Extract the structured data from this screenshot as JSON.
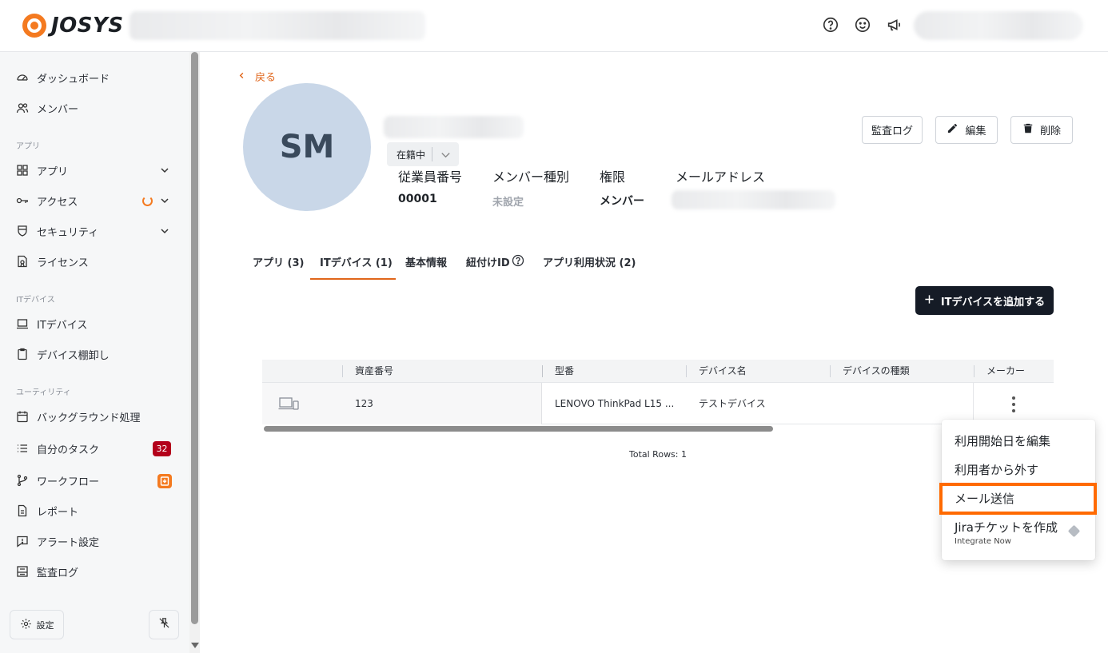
{
  "header": {
    "logo_text": "JOSYS",
    "help_icon": "help-icon",
    "smile_icon": "smile-icon",
    "megaphone_icon": "megaphone-icon"
  },
  "sidebar": {
    "items": [
      {
        "label": "ダッシュボード",
        "icon": "dashboard-icon"
      },
      {
        "label": "メンバー",
        "icon": "members-icon"
      },
      {
        "label": "アプリ",
        "icon": "apps-icon"
      },
      {
        "label": "アクセス",
        "icon": "key-icon"
      },
      {
        "label": "セキュリティ",
        "icon": "shield-icon"
      },
      {
        "label": "ライセンス",
        "icon": "license-icon"
      },
      {
        "label": "ITデバイス",
        "icon": "laptop-icon"
      },
      {
        "label": "デバイス棚卸し",
        "icon": "clipboard-icon"
      },
      {
        "label": "バックグラウンド処理",
        "icon": "calendar-icon"
      },
      {
        "label": "自分のタスク",
        "icon": "tasks-icon"
      },
      {
        "label": "ワークフロー",
        "icon": "workflow-icon"
      },
      {
        "label": "レポート",
        "icon": "report-icon"
      },
      {
        "label": "アラート設定",
        "icon": "alert-icon"
      },
      {
        "label": "監査ログ",
        "icon": "audit-icon"
      }
    ],
    "sections": [
      "アプリ",
      "ITデバイス",
      "ユーティリティ"
    ],
    "task_badge": "32",
    "settings_label": "設定"
  },
  "profile": {
    "back_label": "戻る",
    "initials": "SM",
    "status": "在籍中",
    "fields": [
      {
        "label": "従業員番号",
        "value": "00001"
      },
      {
        "label": "メンバー種別",
        "value": "未設定"
      },
      {
        "label": "権限",
        "value": "メンバー"
      },
      {
        "label": "メールアドレス",
        "value": ""
      }
    ],
    "actions": {
      "audit_log": "監査ログ",
      "edit": "編集",
      "delete": "削除"
    }
  },
  "tabs": [
    {
      "label": "アプリ (3)",
      "active": false
    },
    {
      "label": "ITデバイス (1)",
      "active": true
    },
    {
      "label": "基本情報",
      "active": false
    },
    {
      "label": "紐付けID",
      "active": false
    },
    {
      "label": "アプリ利用状況 (2)",
      "active": false
    }
  ],
  "devices": {
    "add_button": "ITデバイスを追加する",
    "columns": [
      "資産番号",
      "型番",
      "デバイス名",
      "デバイスの種類",
      "メーカー"
    ],
    "rows": [
      {
        "asset_no": "123",
        "model": "LENOVO ThinkPad L15 ...",
        "device_name": "テストデバイス",
        "device_type": "",
        "maker": ""
      }
    ],
    "total_rows": "Total Rows: 1"
  },
  "row_menu": {
    "items": [
      "利用開始日を編集",
      "利用者から外す",
      "メール送信",
      "Jiraチケットを作成"
    ],
    "jira_sub": "Integrate Now",
    "highlighted": "メール送信"
  },
  "colors": {
    "accent": "#e0661b",
    "highlight": "#ff6a00",
    "primary_button": "#151b26",
    "badge_red": "#b3001b"
  }
}
